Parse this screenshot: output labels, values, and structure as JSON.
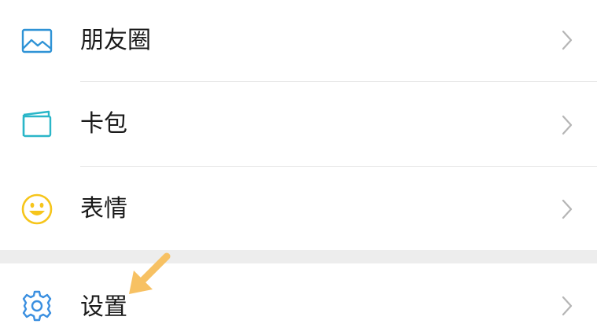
{
  "menu": {
    "items": [
      {
        "label": "朋友圈",
        "icon": "moments-photo-icon"
      },
      {
        "label": "卡包",
        "icon": "card-wallet-icon"
      },
      {
        "label": "表情",
        "icon": "smiley-sticker-icon"
      },
      {
        "label": "设置",
        "icon": "gear-icon"
      }
    ]
  },
  "colors": {
    "moments_blue": "#2f93d6",
    "card_teal": "#2ab6c8",
    "smiley_yellow": "#f6c51b",
    "settings_blue": "#3a8fe0",
    "chevron_gray": "#b5b5b5",
    "pointer_arrow": "#f7c163"
  }
}
